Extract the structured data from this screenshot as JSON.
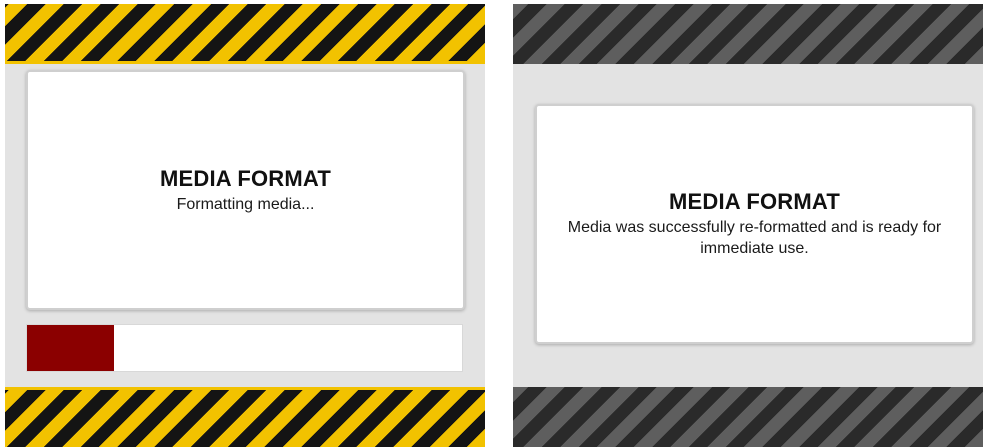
{
  "left_screen": {
    "title": "MEDIA FORMAT",
    "message": "Formatting media...",
    "progress": 0.2,
    "stripe_colors": [
      "#f2c200",
      "#141414"
    ],
    "progress_color": "#8b0000"
  },
  "right_screen": {
    "title": "MEDIA FORMAT",
    "message": "Media was successfully re-formatted and is ready for immediate use.",
    "stripe_colors": [
      "#5e5e5e",
      "#2a2a2a"
    ]
  }
}
